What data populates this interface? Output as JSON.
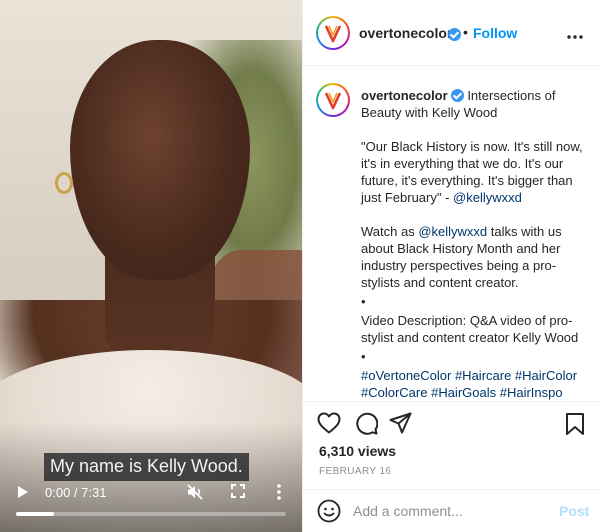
{
  "video": {
    "caption": "My name is Kelly Wood.",
    "current_time": "0:00",
    "duration": "7:31",
    "time_display": "0:00 / 7:31",
    "progress": 0.14
  },
  "header": {
    "username": "overtonecolor",
    "verified": true,
    "separator": "•",
    "follow_label": "Follow",
    "more_icon": "more-horizontal-icon"
  },
  "post": {
    "username": "overtonecolor",
    "title": "Intersections of Beauty with Kelly Wood",
    "quote": "\"Our Black History is now. It's still now, it's in everything that we do. It's our future, it's everything. It's bigger than just February\" - ",
    "quote_handle": "@kellywxxd",
    "watch_prefix": "Watch as ",
    "watch_handle": "@kellywxxd",
    "watch_suffix": " talks with us about Black History Month and her industry perspectives being a pro-stylists and content creator.",
    "bullet1": "•",
    "description": "Video Description: Q&A video of pro-stylist and content creator Kelly Wood",
    "bullet2": "•",
    "hashtags": "#oVertoneColor #Haircare #HairColor #ColorCare #HairGoals #HairInspo #HealthyColor"
  },
  "actions": {
    "icons": [
      "heart-icon",
      "comment-icon",
      "share-icon",
      "bookmark-icon"
    ],
    "views": "6,310 views",
    "date": "FEBRUARY 16"
  },
  "comment": {
    "placeholder": "Add a comment...",
    "post_label": "Post"
  },
  "colors": {
    "accent": "#0095f6",
    "link": "#00376b",
    "post_disabled": "#b2dffc",
    "muted": "#8e8e8e"
  }
}
